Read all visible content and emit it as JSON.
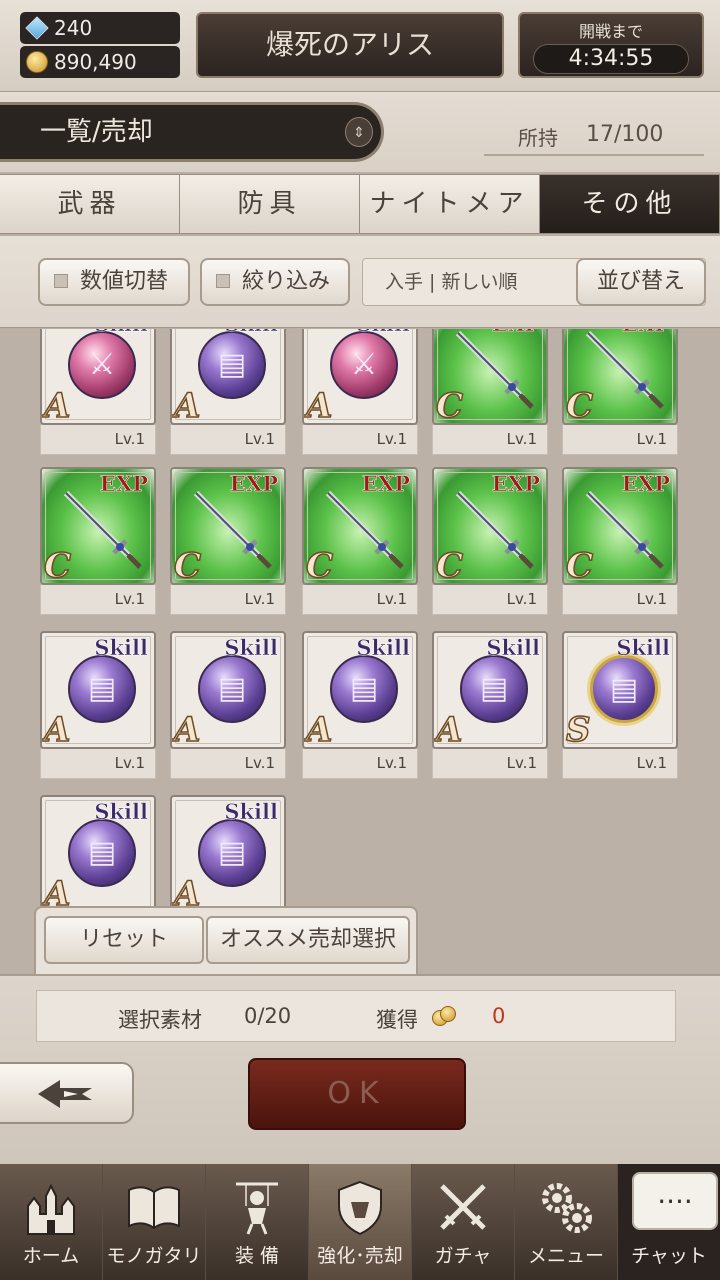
{
  "top": {
    "gems": "240",
    "coins": "890,490",
    "stage_title": "爆死のアリス",
    "battle_label": "開戦まで",
    "battle_timer": "4:34:55"
  },
  "header": {
    "mode": "一覧/売却",
    "owned_label": "所持",
    "owned_value": "17/100"
  },
  "tabs": [
    {
      "label": "武器",
      "active": false
    },
    {
      "label": "防具",
      "active": false
    },
    {
      "label": "ナイトメア",
      "active": false
    },
    {
      "label": "その他",
      "active": true
    }
  ],
  "filters": {
    "value_toggle": "数値切替",
    "narrow": "絞り込み",
    "sort_current": "入手 | 新しい順",
    "sort_button": "並び替え"
  },
  "items": [
    {
      "tag": "Skill",
      "kind": "skill",
      "orb": "pink",
      "glyph": "swords",
      "rank": "A",
      "level": "Lv.1"
    },
    {
      "tag": "Skill",
      "kind": "skill",
      "orb": "purple",
      "glyph": "book",
      "rank": "A",
      "level": "Lv.1"
    },
    {
      "tag": "Skill",
      "kind": "skill",
      "orb": "pink",
      "glyph": "swords",
      "rank": "A",
      "level": "Lv.1"
    },
    {
      "tag": "EXP",
      "kind": "exp",
      "rank": "C",
      "level": "Lv.1"
    },
    {
      "tag": "EXP",
      "kind": "exp",
      "rank": "C",
      "level": "Lv.1"
    },
    {
      "tag": "EXP",
      "kind": "exp",
      "rank": "C",
      "level": "Lv.1"
    },
    {
      "tag": "EXP",
      "kind": "exp",
      "rank": "C",
      "level": "Lv.1"
    },
    {
      "tag": "EXP",
      "kind": "exp",
      "rank": "C",
      "level": "Lv.1"
    },
    {
      "tag": "EXP",
      "kind": "exp",
      "rank": "C",
      "level": "Lv.1"
    },
    {
      "tag": "EXP",
      "kind": "exp",
      "rank": "C",
      "level": "Lv.1"
    },
    {
      "tag": "Skill",
      "kind": "skill",
      "orb": "purple",
      "glyph": "book",
      "rank": "A",
      "level": "Lv.1"
    },
    {
      "tag": "Skill",
      "kind": "skill",
      "orb": "purple",
      "glyph": "book",
      "rank": "A",
      "level": "Lv.1"
    },
    {
      "tag": "Skill",
      "kind": "skill",
      "orb": "purple",
      "glyph": "book",
      "rank": "A",
      "level": "Lv.1"
    },
    {
      "tag": "Skill",
      "kind": "skill",
      "orb": "purple",
      "glyph": "book",
      "rank": "A",
      "level": "Lv.1"
    },
    {
      "tag": "Skill",
      "kind": "skill",
      "orb": "purple",
      "glyph": "book",
      "rank": "S",
      "level": "Lv.1",
      "special": true
    },
    {
      "tag": "Skill",
      "kind": "skill",
      "orb": "purple",
      "glyph": "book",
      "rank": "A",
      "level": ""
    },
    {
      "tag": "Skill",
      "kind": "skill",
      "orb": "purple",
      "glyph": "book",
      "rank": "A",
      "level": ""
    }
  ],
  "actions": {
    "reset": "リセット",
    "recommend": "オススメ売却選択"
  },
  "status": {
    "selected_label": "選択素材",
    "selected_value": "0/20",
    "gain_label": "獲得",
    "gain_value": "0"
  },
  "ok_label": "OK",
  "nav": [
    {
      "label": "ホーム",
      "icon": "castle-icon",
      "active": false
    },
    {
      "label": "モノガタリ",
      "icon": "book-icon",
      "active": false
    },
    {
      "label": "装 備",
      "icon": "puppet-icon",
      "active": false
    },
    {
      "label": "強化･売却",
      "icon": "shield-icon",
      "active": true
    },
    {
      "label": "ガチャ",
      "icon": "crossed-swords-icon",
      "active": false
    },
    {
      "label": "メニュー",
      "icon": "gears-icon",
      "active": false
    }
  ],
  "chat": {
    "bubble": "....",
    "label": "チャット"
  }
}
